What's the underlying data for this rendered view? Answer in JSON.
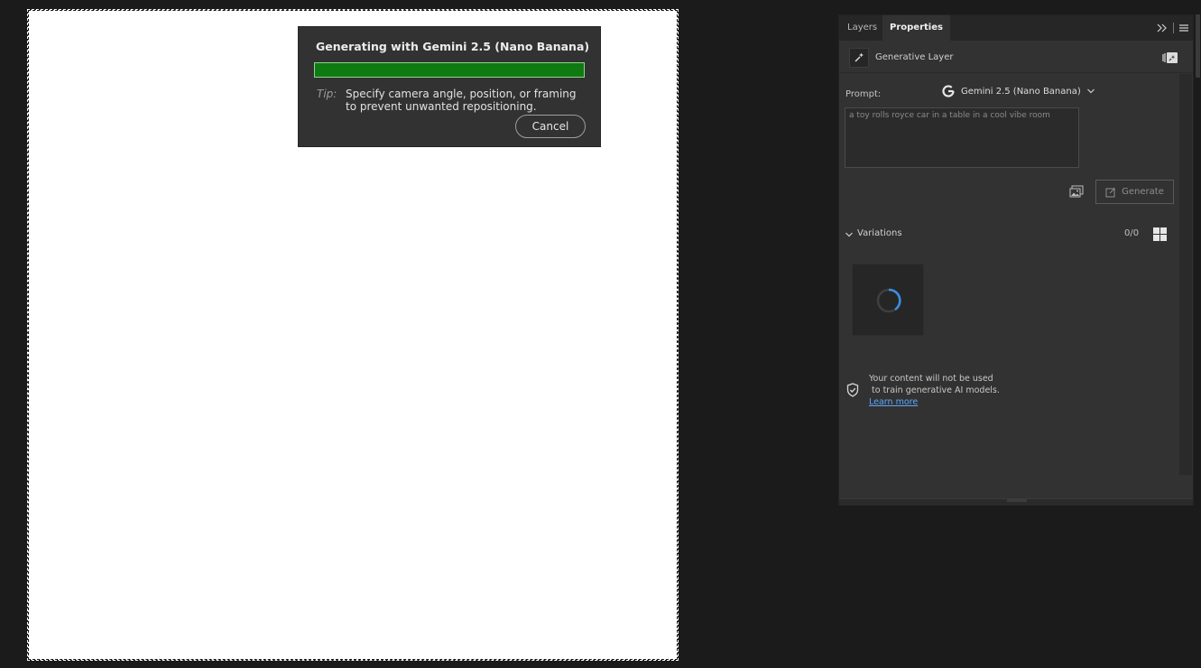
{
  "dialog": {
    "title": "Generating with Gemini 2.5 (Nano Banana)",
    "progress": 1.0,
    "progress_color": "#0f7a12",
    "tip_label": "Tip:",
    "tip_text": "Specify camera angle, position, or framing to prevent unwanted repositioning.",
    "cancel_label": "Cancel"
  },
  "panel": {
    "tabs": [
      {
        "label": "Layers",
        "active": false
      },
      {
        "label": "Properties",
        "active": true
      }
    ],
    "layer_type": "Generative Layer",
    "prompt_label": "Prompt:",
    "model_label": "Gemini 2.5 (Nano Banana)",
    "prompt_text": "a toy rolls royce car in a table in a cool vibe room",
    "generate_label": "Generate",
    "variations_label": "Variations",
    "variations_count": "0/0",
    "privacy_text": "Your content will not be used\n to train generative AI models.",
    "learn_more_label": "Learn more",
    "accent_color": "#5aa7ff"
  }
}
